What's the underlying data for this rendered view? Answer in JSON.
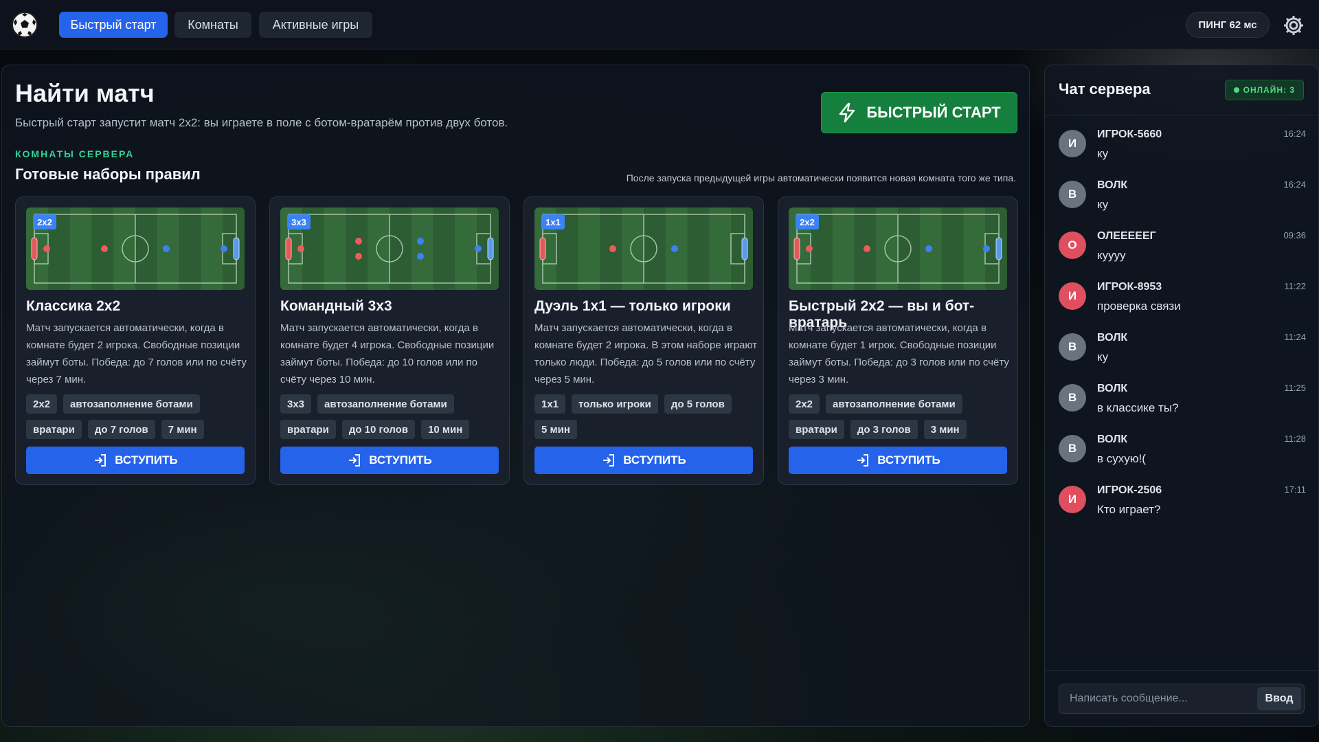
{
  "topbar": {
    "tabs": [
      {
        "label": "Быстрый старт",
        "active": true
      },
      {
        "label": "Комнаты",
        "active": false
      },
      {
        "label": "Активные игры",
        "active": false
      }
    ],
    "ping": "ПИНГ 62 мс"
  },
  "main": {
    "title": "Найти матч",
    "subtitle": "Быстрый старт запустит матч 2x2: вы играете в поле с ботом-вратарём против двух ботов.",
    "quick_start_label": "БЫСТРЫЙ СТАРТ",
    "section_label": "КОМНАТЫ СЕРВЕРА",
    "section_title": "Готовые наборы правил",
    "note": "После запуска предыдущей игры автоматически появится новая комната того же типа."
  },
  "cards": [
    {
      "badge": "2x2",
      "title": "Классика 2x2",
      "description": "Матч запускается автоматически, когда в комнате будет 2 игрока. Свободные позиции займут боты. Победа: до 7 голов или по счёту через 7 мин.",
      "tags": [
        "2x2",
        "автозаполнение ботами",
        "вратари",
        "до 7 голов",
        "7 мин"
      ],
      "join_label": "ВСТУПИТЬ"
    },
    {
      "badge": "3x3",
      "title": "Командный 3x3",
      "description": "Матч запускается автоматически, когда в комнате будет 4 игрока. Свободные позиции займут боты. Победа: до 10 голов или по счёту через 10 мин.",
      "tags": [
        "3x3",
        "автозаполнение ботами",
        "вратари",
        "до 10 голов",
        "10 мин"
      ],
      "join_label": "ВСТУПИТЬ"
    },
    {
      "badge": "1x1",
      "title": "Дуэль 1x1 — только игроки",
      "description": "Матч запускается автоматически, когда в комнате будет 2 игрока. В этом наборе играют только люди. Победа: до 5 голов или по счёту через 5 мин.",
      "tags": [
        "1x1",
        "только игроки",
        "до 5 голов",
        "5 мин"
      ],
      "join_label": "ВСТУПИТЬ"
    },
    {
      "badge": "2x2",
      "title": "Быстрый 2x2 — вы и бот-вратарь",
      "description": "Матч запускается автоматически, когда в комнате будет 1 игрок. Свободные позиции займут боты. Победа: до 3 голов или по счёту через 3 мин.",
      "tags": [
        "2x2",
        "автозаполнение ботами",
        "вратари",
        "до 3 голов",
        "3 мин"
      ],
      "join_label": "ВСТУПИТЬ"
    }
  ],
  "chat": {
    "title": "Чат сервера",
    "online": "ОНЛАЙН: 3",
    "messages": [
      {
        "initial": "И",
        "name": "ИГРОК-5660",
        "text": "ку",
        "time": "16:24",
        "color": "#6b7280"
      },
      {
        "initial": "В",
        "name": "ВОЛК",
        "text": "ку",
        "time": "16:24",
        "color": "#6b7280"
      },
      {
        "initial": "О",
        "name": "ОЛЕЕЕЕЕГ",
        "text": "куууу",
        "time": "09:36",
        "color": "#e04f5f"
      },
      {
        "initial": "И",
        "name": "ИГРОК-8953",
        "text": "проверка связи",
        "time": "11:22",
        "color": "#e04f5f"
      },
      {
        "initial": "В",
        "name": "ВОЛК",
        "text": "ку",
        "time": "11:24",
        "color": "#6b7280"
      },
      {
        "initial": "В",
        "name": "ВОЛК",
        "text": "в классике ты?",
        "time": "11:25",
        "color": "#6b7280"
      },
      {
        "initial": "В",
        "name": "ВОЛК",
        "text": "в сухую!(",
        "time": "11:28",
        "color": "#6b7280"
      },
      {
        "initial": "И",
        "name": "ИГРОК-2506",
        "text": "Кто играет?",
        "time": "17:11",
        "color": "#e04f5f"
      }
    ],
    "input_placeholder": "Написать сообщение...",
    "send_label": "Ввод"
  },
  "colors": {
    "accent_blue": "#2563eb",
    "quick_start_green": "#15803d",
    "section_green": "#34d399",
    "team_red": "#ef5b5b",
    "team_blue": "#3b82f6"
  }
}
